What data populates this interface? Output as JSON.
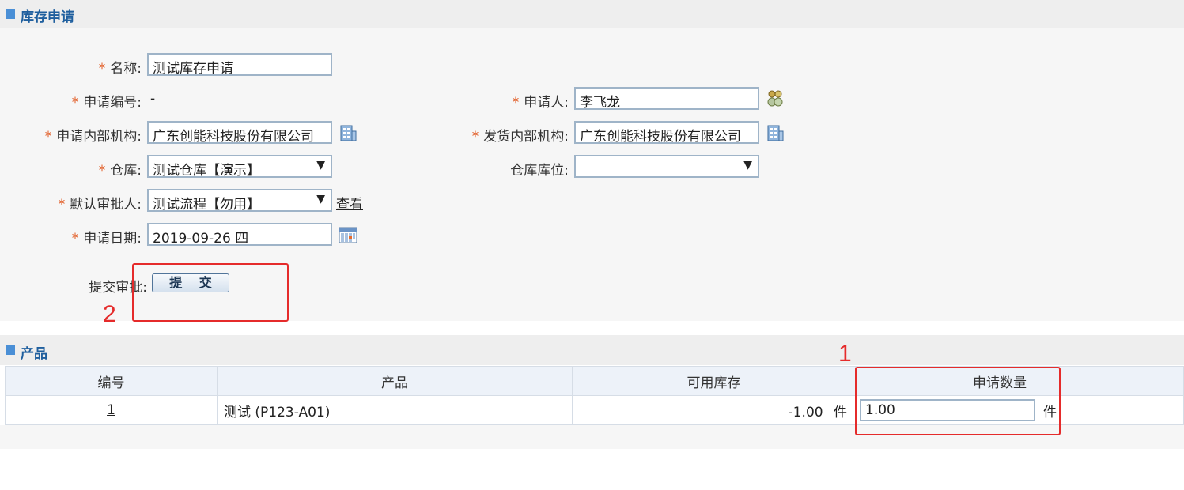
{
  "inventory_section": {
    "title": "库存申请"
  },
  "form": {
    "name": {
      "label": "名称:",
      "required": "*",
      "value": "测试库存申请"
    },
    "apply_no": {
      "label": "申请编号:",
      "required": "*",
      "value": "-"
    },
    "applicant": {
      "label": "申请人:",
      "required": "*",
      "value": "李飞龙"
    },
    "apply_org": {
      "label": "申请内部机构:",
      "required": "*",
      "value": "广东创能科技股份有限公司"
    },
    "ship_org": {
      "label": "发货内部机构:",
      "required": "*",
      "value": "广东创能科技股份有限公司"
    },
    "warehouse": {
      "label": "仓库:",
      "required": "*",
      "value": "测试仓库【演示】"
    },
    "location": {
      "label": "仓库库位:",
      "value": ""
    },
    "approver": {
      "label": "默认审批人:",
      "required": "*",
      "value": "测试流程【勿用】",
      "view_link": "查看"
    },
    "apply_date": {
      "label": "申请日期:",
      "required": "*",
      "value": "2019-09-26 四"
    },
    "submit": {
      "label": "提交审批:",
      "button": "提 交"
    },
    "dropdown_arrow": "▼"
  },
  "annotations": {
    "box1_number": "1",
    "box2_number": "2"
  },
  "product_section": {
    "title": "产品",
    "columns": [
      "编号",
      "产品",
      "可用库存",
      "申请数量",
      ""
    ],
    "rows": [
      {
        "no": "1",
        "product": "测试 (P123-A01)",
        "stock": "-1.00",
        "stock_unit": "件",
        "qty": "1.00",
        "qty_unit": "件"
      }
    ]
  },
  "icons": {
    "applicant": "people-icon",
    "org": "building-icon",
    "date": "calendar-icon"
  },
  "colors": {
    "accent": "#1f5f9e",
    "required": "#e0541a",
    "annotation": "#e52b2b"
  }
}
